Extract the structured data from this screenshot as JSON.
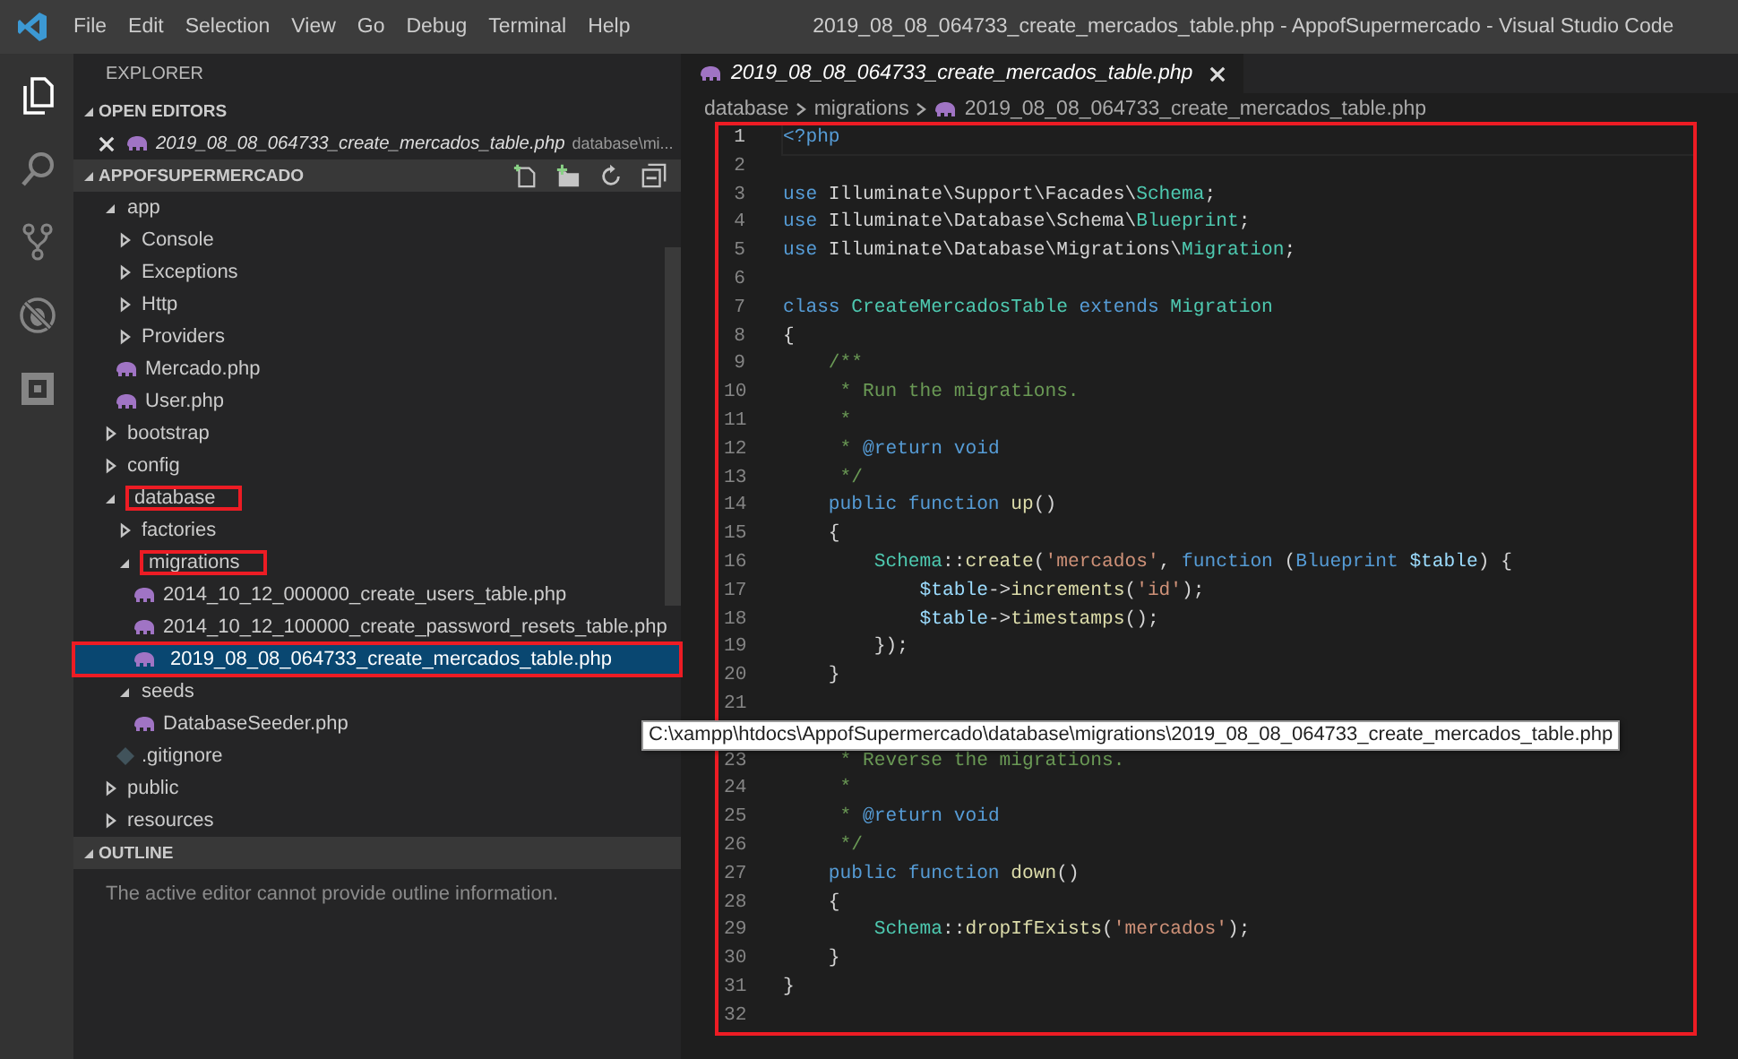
{
  "window": {
    "title": "2019_08_08_064733_create_mercados_table.php - AppofSupermercado - Visual Studio Code"
  },
  "menu": [
    "File",
    "Edit",
    "Selection",
    "View",
    "Go",
    "Debug",
    "Terminal",
    "Help"
  ],
  "activity_bar": [
    {
      "kind": "files",
      "selected": true
    },
    {
      "kind": "search",
      "selected": false
    },
    {
      "kind": "scm",
      "selected": false
    },
    {
      "kind": "debug",
      "selected": false
    },
    {
      "kind": "extensions",
      "selected": false
    }
  ],
  "sidebar": {
    "title": "EXPLORER",
    "open_editors": {
      "title": "OPEN EDITORS",
      "expanded": true,
      "items": [
        {
          "name": "2019_08_08_064733_create_mercados_table.php",
          "description": "database\\mi..."
        }
      ]
    },
    "folder": {
      "title": "APPOFSUPERMERCADO",
      "expanded": true,
      "items": [
        {
          "name": "app",
          "kind": "folder",
          "expanded": true,
          "selected": false,
          "highlighted": false,
          "children": [
            {
              "name": "Console",
              "kind": "folder",
              "expanded": false,
              "selected": false,
              "highlighted": false
            },
            {
              "name": "Exceptions",
              "kind": "folder",
              "expanded": false,
              "selected": false,
              "highlighted": false
            },
            {
              "name": "Http",
              "kind": "folder",
              "expanded": false,
              "selected": false,
              "highlighted": false
            },
            {
              "name": "Providers",
              "kind": "folder",
              "expanded": false,
              "selected": false,
              "highlighted": false
            },
            {
              "name": "Mercado.php",
              "kind": "php",
              "selected": false,
              "highlighted": false
            },
            {
              "name": "User.php",
              "kind": "php",
              "selected": false,
              "highlighted": false
            }
          ]
        },
        {
          "name": "bootstrap",
          "kind": "folder",
          "expanded": false,
          "selected": false,
          "highlighted": false
        },
        {
          "name": "config",
          "kind": "folder",
          "expanded": false,
          "selected": false,
          "highlighted": false
        },
        {
          "name": "database",
          "kind": "folder",
          "expanded": true,
          "selected": false,
          "highlighted": true,
          "children": [
            {
              "name": "factories",
              "kind": "folder",
              "expanded": false,
              "selected": false,
              "highlighted": false
            },
            {
              "name": "migrations",
              "kind": "folder",
              "expanded": true,
              "selected": false,
              "highlighted": true,
              "children": [
                {
                  "name": "2014_10_12_000000_create_users_table.php",
                  "kind": "php",
                  "selected": false,
                  "highlighted": false
                },
                {
                  "name": "2014_10_12_100000_create_password_resets_table.php",
                  "kind": "php",
                  "selected": false,
                  "highlighted": false
                },
                {
                  "name": "2019_08_08_064733_create_mercados_table.php",
                  "kind": "php",
                  "selected": true,
                  "highlighted": true
                }
              ]
            },
            {
              "name": "seeds",
              "kind": "folder",
              "expanded": true,
              "selected": false,
              "highlighted": false,
              "children": [
                {
                  "name": "DatabaseSeeder.php",
                  "kind": "php",
                  "selected": false,
                  "highlighted": false
                }
              ]
            },
            {
              "name": ".gitignore",
              "kind": "git",
              "selected": false,
              "highlighted": false
            }
          ]
        },
        {
          "name": "public",
          "kind": "folder",
          "expanded": false,
          "selected": false,
          "highlighted": false
        },
        {
          "name": "resources",
          "kind": "folder",
          "expanded": false,
          "selected": false,
          "highlighted": false
        }
      ]
    },
    "outline": {
      "title": "OUTLINE",
      "expanded": true,
      "message": "The active editor cannot provide outline information."
    }
  },
  "tabs": [
    {
      "label": "2019_08_08_064733_create_mercados_table.php",
      "selected": true
    }
  ],
  "breadcrumbs": [
    {
      "label": "database",
      "kind": "folder"
    },
    {
      "label": "migrations",
      "kind": "folder"
    },
    {
      "label": "2019_08_08_064733_create_mercados_table.php",
      "kind": "php"
    }
  ],
  "editor": {
    "highlighted": true,
    "lines": [
      {
        "number": "1",
        "current": true,
        "tokens": [
          {
            "kind": "kw",
            "text": "<?php"
          }
        ]
      },
      {
        "number": "2",
        "current": false
      },
      {
        "number": "3",
        "current": false,
        "tokens": [
          {
            "kind": "kw",
            "text": "use"
          },
          {
            "kind": "plain",
            "text": " Illuminate\\Support\\Facades\\"
          },
          {
            "kind": "type",
            "text": "Schema"
          },
          {
            "kind": "plain",
            "text": ";"
          }
        ]
      },
      {
        "number": "4",
        "current": false,
        "tokens": [
          {
            "kind": "kw",
            "text": "use"
          },
          {
            "kind": "plain",
            "text": " Illuminate\\Database\\Schema\\"
          },
          {
            "kind": "type",
            "text": "Blueprint"
          },
          {
            "kind": "plain",
            "text": ";"
          }
        ]
      },
      {
        "number": "5",
        "current": false,
        "tokens": [
          {
            "kind": "kw",
            "text": "use"
          },
          {
            "kind": "plain",
            "text": " Illuminate\\Database\\Migrations\\"
          },
          {
            "kind": "type",
            "text": "Migration"
          },
          {
            "kind": "plain",
            "text": ";"
          }
        ]
      },
      {
        "number": "6",
        "current": false
      },
      {
        "number": "7",
        "current": false,
        "tokens": [
          {
            "kind": "kw",
            "text": "class"
          },
          {
            "kind": "type",
            "text": " CreateMercadosTable"
          },
          {
            "kind": "kw",
            "text": " extends"
          },
          {
            "kind": "type",
            "text": " Migration"
          }
        ]
      },
      {
        "number": "8",
        "current": false,
        "tokens": [
          {
            "kind": "plain",
            "text": "{"
          }
        ]
      },
      {
        "number": "9",
        "current": false,
        "tokens": [
          {
            "kind": "comment",
            "text": "    /**"
          }
        ]
      },
      {
        "number": "10",
        "current": false,
        "tokens": [
          {
            "kind": "comment",
            "text": "     * Run the migrations."
          }
        ]
      },
      {
        "number": "11",
        "current": false,
        "tokens": [
          {
            "kind": "comment",
            "text": "     *"
          }
        ]
      },
      {
        "number": "12",
        "current": false,
        "tokens": [
          {
            "kind": "comment",
            "text": "     * "
          },
          {
            "kind": "kw",
            "text": "@return void"
          }
        ]
      },
      {
        "number": "13",
        "current": false,
        "tokens": [
          {
            "kind": "comment",
            "text": "     */"
          }
        ]
      },
      {
        "number": "14",
        "current": false,
        "tokens": [
          {
            "kind": "kw",
            "text": "    public function"
          },
          {
            "kind": "fn",
            "text": " up"
          },
          {
            "kind": "plain",
            "text": "()"
          }
        ]
      },
      {
        "number": "15",
        "current": false,
        "tokens": [
          {
            "kind": "plain",
            "text": "    {"
          }
        ]
      },
      {
        "number": "16",
        "current": false,
        "tokens": [
          {
            "kind": "type",
            "text": "        Schema"
          },
          {
            "kind": "plain",
            "text": "::"
          },
          {
            "kind": "fn",
            "text": "create"
          },
          {
            "kind": "plain",
            "text": "("
          },
          {
            "kind": "str",
            "text": "'mercados'"
          },
          {
            "kind": "plain",
            "text": ", "
          },
          {
            "kind": "kw",
            "text": "function"
          },
          {
            "kind": "plain",
            "text": " ("
          },
          {
            "kind": "kw",
            "text": "Blueprint"
          },
          {
            "kind": "var",
            "text": " $table"
          },
          {
            "kind": "plain",
            "text": ") {"
          }
        ]
      },
      {
        "number": "17",
        "current": false,
        "tokens": [
          {
            "kind": "var",
            "text": "            $table"
          },
          {
            "kind": "plain",
            "text": "->"
          },
          {
            "kind": "fn",
            "text": "increments"
          },
          {
            "kind": "plain",
            "text": "("
          },
          {
            "kind": "str",
            "text": "'id'"
          },
          {
            "kind": "plain",
            "text": ");"
          }
        ]
      },
      {
        "number": "18",
        "current": false,
        "tokens": [
          {
            "kind": "var",
            "text": "            $table"
          },
          {
            "kind": "plain",
            "text": "->"
          },
          {
            "kind": "fn",
            "text": "timestamps"
          },
          {
            "kind": "plain",
            "text": "();"
          }
        ]
      },
      {
        "number": "19",
        "current": false,
        "tokens": [
          {
            "kind": "plain",
            "text": "        });"
          }
        ]
      },
      {
        "number": "20",
        "current": false,
        "tokens": [
          {
            "kind": "plain",
            "text": "    }"
          }
        ]
      },
      {
        "number": "21",
        "current": false
      },
      {
        "kind": "tooltip",
        "text": "C:\\xampp\\htdocs\\AppofSupermercado\\database\\migrations\\2019_08_08_064733_create_mercados_table.php"
      },
      {
        "number": "23",
        "current": false,
        "tokens": [
          {
            "kind": "comment",
            "text": "     * Reverse the migrations."
          }
        ]
      },
      {
        "number": "24",
        "current": false,
        "tokens": [
          {
            "kind": "comment",
            "text": "     *"
          }
        ]
      },
      {
        "number": "25",
        "current": false,
        "tokens": [
          {
            "kind": "comment",
            "text": "     * "
          },
          {
            "kind": "kw",
            "text": "@return void"
          }
        ]
      },
      {
        "number": "26",
        "current": false,
        "tokens": [
          {
            "kind": "comment",
            "text": "     */"
          }
        ]
      },
      {
        "number": "27",
        "current": false,
        "tokens": [
          {
            "kind": "kw",
            "text": "    public function"
          },
          {
            "kind": "fn",
            "text": " down"
          },
          {
            "kind": "plain",
            "text": "()"
          }
        ]
      },
      {
        "number": "28",
        "current": false,
        "tokens": [
          {
            "kind": "plain",
            "text": "    {"
          }
        ]
      },
      {
        "number": "29",
        "current": false,
        "tokens": [
          {
            "kind": "type",
            "text": "        Schema"
          },
          {
            "kind": "plain",
            "text": "::"
          },
          {
            "kind": "fn",
            "text": "dropIfExists"
          },
          {
            "kind": "plain",
            "text": "("
          },
          {
            "kind": "str",
            "text": "'mercados'"
          },
          {
            "kind": "plain",
            "text": ");"
          }
        ]
      },
      {
        "number": "30",
        "current": false,
        "tokens": [
          {
            "kind": "plain",
            "text": "    }"
          }
        ]
      },
      {
        "number": "31",
        "current": false,
        "tokens": [
          {
            "kind": "plain",
            "text": "}"
          }
        ]
      },
      {
        "number": "32",
        "current": false
      }
    ]
  }
}
